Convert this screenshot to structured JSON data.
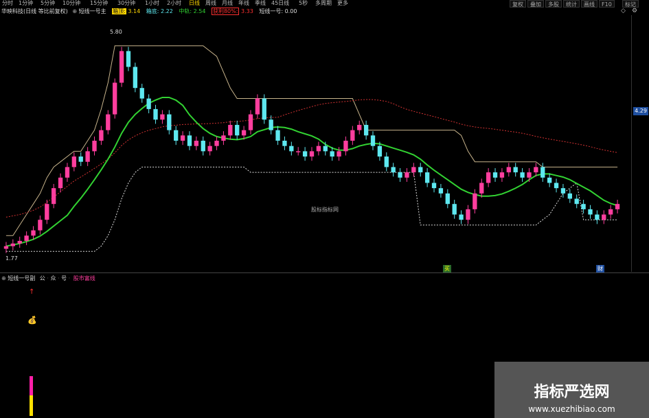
{
  "toolbar": {
    "items": [
      "分时",
      "1分钟",
      "5分钟",
      "10分钟",
      "15分钟",
      "30分钟",
      "1小时",
      "2小时",
      "日线",
      "周线",
      "月线",
      "年线",
      "季线",
      "45日线",
      "5秒",
      "多周期",
      "更多"
    ],
    "active_index": 8,
    "right_buttons": [
      "复权",
      "叠加",
      "多股",
      "统计",
      "画线",
      "F10",
      "标记"
    ]
  },
  "main_info": {
    "stock": "华映科技(日线 等比前复权)",
    "indicator": "短线一号主",
    "box_top_label": "箱顶:",
    "box_top_value": "3.14",
    "box_bottom_label": "箱底:",
    "box_bottom_value": "2.22",
    "mid_label": "中轨:",
    "mid_value": "2.54",
    "profit_label": "获利80%:",
    "profit_value": "3.33",
    "extra": "短线一号: 0.00"
  },
  "sub_info": {
    "name": "短线一号副",
    "items": [
      "公",
      "众",
      "号",
      "股市富线"
    ]
  },
  "labels": {
    "high_price": "5.80",
    "low_price": "1.77",
    "current_price": "4.29",
    "center_watermark": "股标指标网",
    "signal_a": "买",
    "signal_b": "财"
  },
  "watermark": {
    "title": "指标严选网",
    "url": "www.xuezhibiao.com"
  },
  "colors": {
    "up": "#ff3e9e",
    "down": "#5ee8f0",
    "ma": "#32d232",
    "box_top": "#c8b48c",
    "trail": "#d23232",
    "support": "#dddddd"
  },
  "chart_data": {
    "type": "candlestick",
    "closes": [
      1.8,
      1.85,
      1.9,
      2.0,
      2.1,
      2.3,
      2.6,
      2.9,
      3.1,
      3.3,
      3.5,
      3.4,
      3.6,
      3.8,
      4.0,
      4.3,
      4.9,
      5.5,
      5.2,
      4.8,
      4.6,
      4.4,
      4.2,
      4.3,
      4.0,
      3.8,
      3.9,
      3.7,
      3.8,
      3.6,
      3.7,
      3.8,
      3.9,
      4.1,
      3.9,
      4.0,
      4.3,
      4.6,
      4.2,
      4.0,
      3.8,
      3.7,
      3.6,
      3.6,
      3.5,
      3.6,
      3.7,
      3.6,
      3.5,
      3.6,
      3.8,
      4.0,
      4.1,
      3.9,
      3.7,
      3.5,
      3.3,
      3.2,
      3.1,
      3.2,
      3.3,
      3.2,
      3.0,
      2.9,
      2.8,
      2.6,
      2.4,
      2.3,
      2.5,
      2.8,
      3.0,
      3.2,
      3.1,
      3.2,
      3.3,
      3.2,
      3.1,
      3.2,
      3.3,
      3.1,
      3.0,
      2.9,
      2.8,
      2.7,
      2.6,
      2.5,
      2.4,
      2.3,
      2.4,
      2.5,
      2.6
    ],
    "box_top": [
      2.0,
      2.0,
      2.2,
      2.4,
      2.6,
      2.8,
      3.1,
      3.3,
      3.4,
      3.5,
      3.6,
      3.6,
      3.8,
      4.0,
      4.4,
      4.9,
      5.6,
      5.6,
      5.6,
      5.6,
      5.6,
      5.6,
      5.6,
      5.6,
      5.6,
      5.6,
      5.6,
      5.6,
      5.6,
      5.6,
      5.5,
      5.4,
      5.1,
      4.8,
      4.6,
      4.6,
      4.6,
      4.6,
      4.6,
      4.6,
      4.6,
      4.6,
      4.6,
      4.6,
      4.6,
      4.6,
      4.6,
      4.6,
      4.6,
      4.6,
      4.6,
      4.6,
      4.3,
      4.0,
      4.0,
      4.0,
      4.0,
      4.0,
      4.0,
      4.0,
      4.0,
      4.0,
      4.0,
      4.0,
      4.0,
      4.0,
      4.0,
      3.9,
      3.6,
      3.4,
      3.4,
      3.4,
      3.4,
      3.4,
      3.4,
      3.4,
      3.4,
      3.4,
      3.4,
      3.3,
      3.3,
      3.3,
      3.3,
      3.3,
      3.3,
      3.3,
      3.3,
      3.3,
      3.3,
      3.3,
      3.3
    ],
    "support": [
      1.7,
      1.7,
      1.7,
      1.7,
      1.7,
      1.7,
      1.7,
      1.7,
      1.7,
      1.7,
      1.7,
      1.7,
      1.7,
      1.7,
      1.8,
      2.0,
      2.3,
      2.7,
      3.0,
      3.2,
      3.3,
      3.3,
      3.3,
      3.3,
      3.3,
      3.3,
      3.3,
      3.3,
      3.3,
      3.3,
      3.3,
      3.3,
      3.3,
      3.3,
      3.3,
      3.3,
      3.2,
      3.2,
      3.2,
      3.2,
      3.2,
      3.2,
      3.2,
      3.2,
      3.2,
      3.2,
      3.2,
      3.2,
      3.2,
      3.2,
      3.2,
      3.2,
      3.2,
      3.2,
      3.2,
      3.2,
      3.2,
      3.2,
      3.2,
      3.2,
      3.2,
      2.2,
      2.2,
      2.2,
      2.2,
      2.2,
      2.2,
      2.2,
      2.2,
      2.2,
      2.2,
      2.2,
      2.2,
      2.2,
      2.2,
      2.2,
      2.2,
      2.2,
      2.2,
      2.3,
      2.4,
      2.6,
      2.8,
      2.9,
      3.0,
      2.3,
      2.3,
      2.3,
      2.3,
      2.3,
      2.3
    ],
    "ylim": [
      1.6,
      6.0
    ]
  }
}
